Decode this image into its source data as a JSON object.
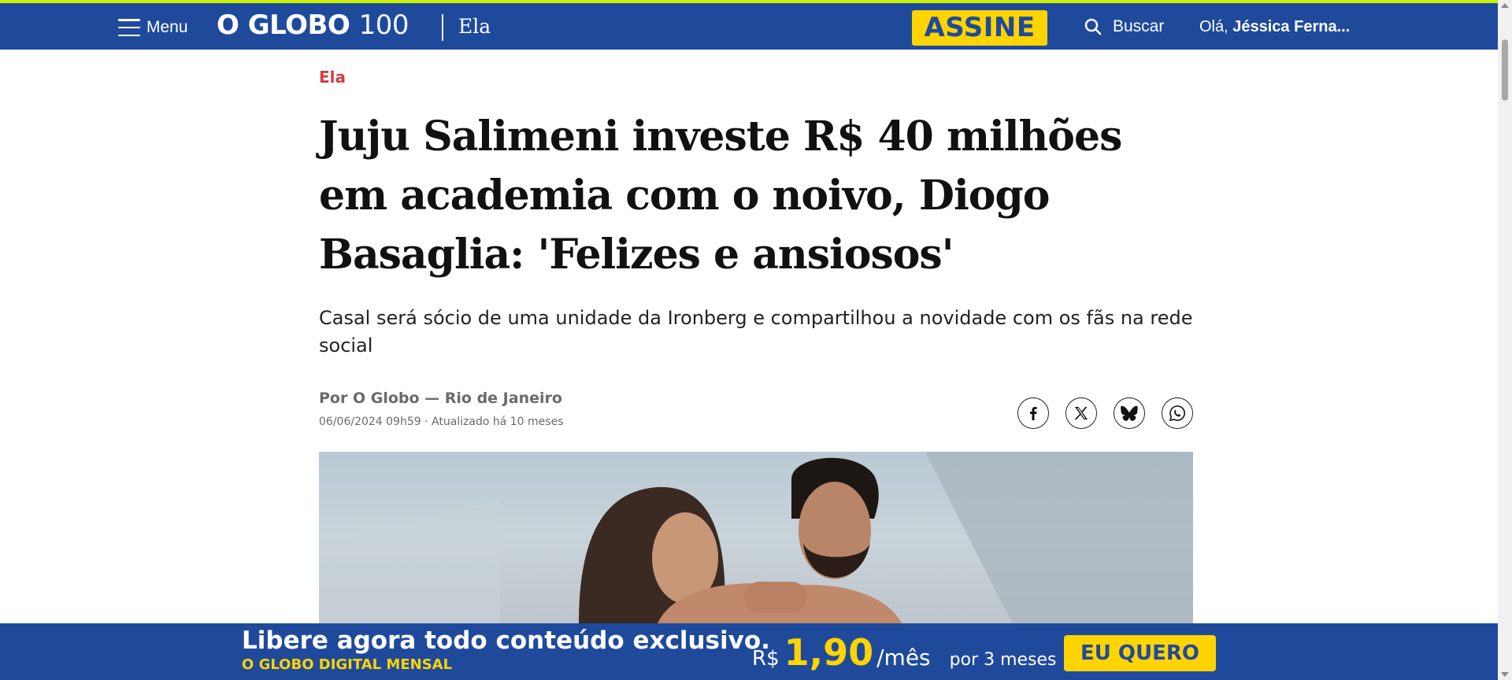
{
  "topbar": {
    "menu_label": "Menu",
    "logo_text": "O GLOBO",
    "logo_suffix": "100",
    "section": "Ela",
    "subscribe": "ASSINE",
    "search_label": "Buscar",
    "greeting": "Olá,",
    "user_name": "Jéssica Ferna...",
    "colors": {
      "bar": "#1f4a9c",
      "accent": "#ffd400",
      "top_line": "#c9f000"
    }
  },
  "article": {
    "kicker": "Ela",
    "title": "Juju Salimeni investe R$ 40 milhões em academia com o noivo, Diogo Basaglia: 'Felizes e ansiosos'",
    "subtitle": "Casal será sócio de uma unidade da Ironberg e compartilhou a novidade com os fãs na rede social",
    "byline": "Por O Globo — Rio de Janeiro",
    "dateline": "06/06/2024 09h59 · Atualizado há 10 meses",
    "share_icons": [
      "facebook-icon",
      "x-icon",
      "bluesky-icon",
      "whatsapp-icon"
    ],
    "kicker_color": "#d43b43"
  },
  "banner": {
    "headline": "Libere agora todo conteúdo exclusivo.",
    "product": "O GLOBO DIGITAL MENSAL",
    "currency": "R$",
    "price": "1,90",
    "period": "/mês",
    "terms": "por 3 meses",
    "cta": "EU QUERO"
  }
}
